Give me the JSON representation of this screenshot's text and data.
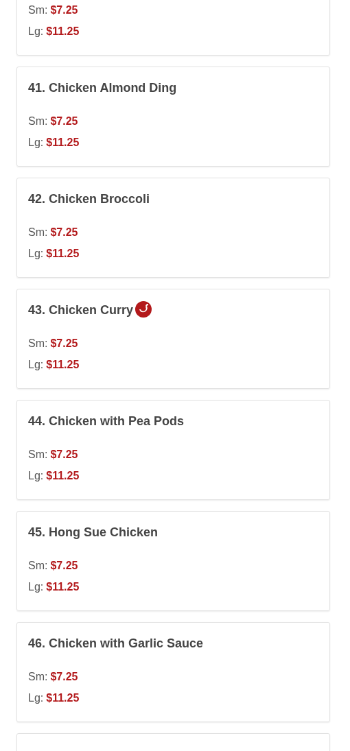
{
  "menu_items": [
    {
      "prices": [
        {
          "label": "Sm:",
          "price": "$7.25"
        },
        {
          "label": "Lg:",
          "price": "$11.25"
        }
      ],
      "spicy": false
    },
    {
      "name": "41. Chicken Almond Ding",
      "prices": [
        {
          "label": "Sm:",
          "price": "$7.25"
        },
        {
          "label": "Lg:",
          "price": "$11.25"
        }
      ],
      "spicy": false
    },
    {
      "name": "42. Chicken Broccoli",
      "prices": [
        {
          "label": "Sm:",
          "price": "$7.25"
        },
        {
          "label": "Lg:",
          "price": "$11.25"
        }
      ],
      "spicy": false
    },
    {
      "name": "43. Chicken Curry",
      "prices": [
        {
          "label": "Sm:",
          "price": "$7.25"
        },
        {
          "label": "Lg:",
          "price": "$11.25"
        }
      ],
      "spicy": true
    },
    {
      "name": "44. Chicken with Pea Pods",
      "prices": [
        {
          "label": "Sm:",
          "price": "$7.25"
        },
        {
          "label": "Lg:",
          "price": "$11.25"
        }
      ],
      "spicy": false
    },
    {
      "name": "45. Hong Sue Chicken",
      "prices": [
        {
          "label": "Sm:",
          "price": "$7.25"
        },
        {
          "label": "Lg:",
          "price": "$11.25"
        }
      ],
      "spicy": false
    },
    {
      "name": "46. Chicken with Garlic Sauce",
      "prices": [
        {
          "label": "Sm:",
          "price": "$7.25"
        },
        {
          "label": "Lg:",
          "price": "$11.25"
        }
      ],
      "spicy": false
    },
    {
      "spicy": false
    }
  ]
}
